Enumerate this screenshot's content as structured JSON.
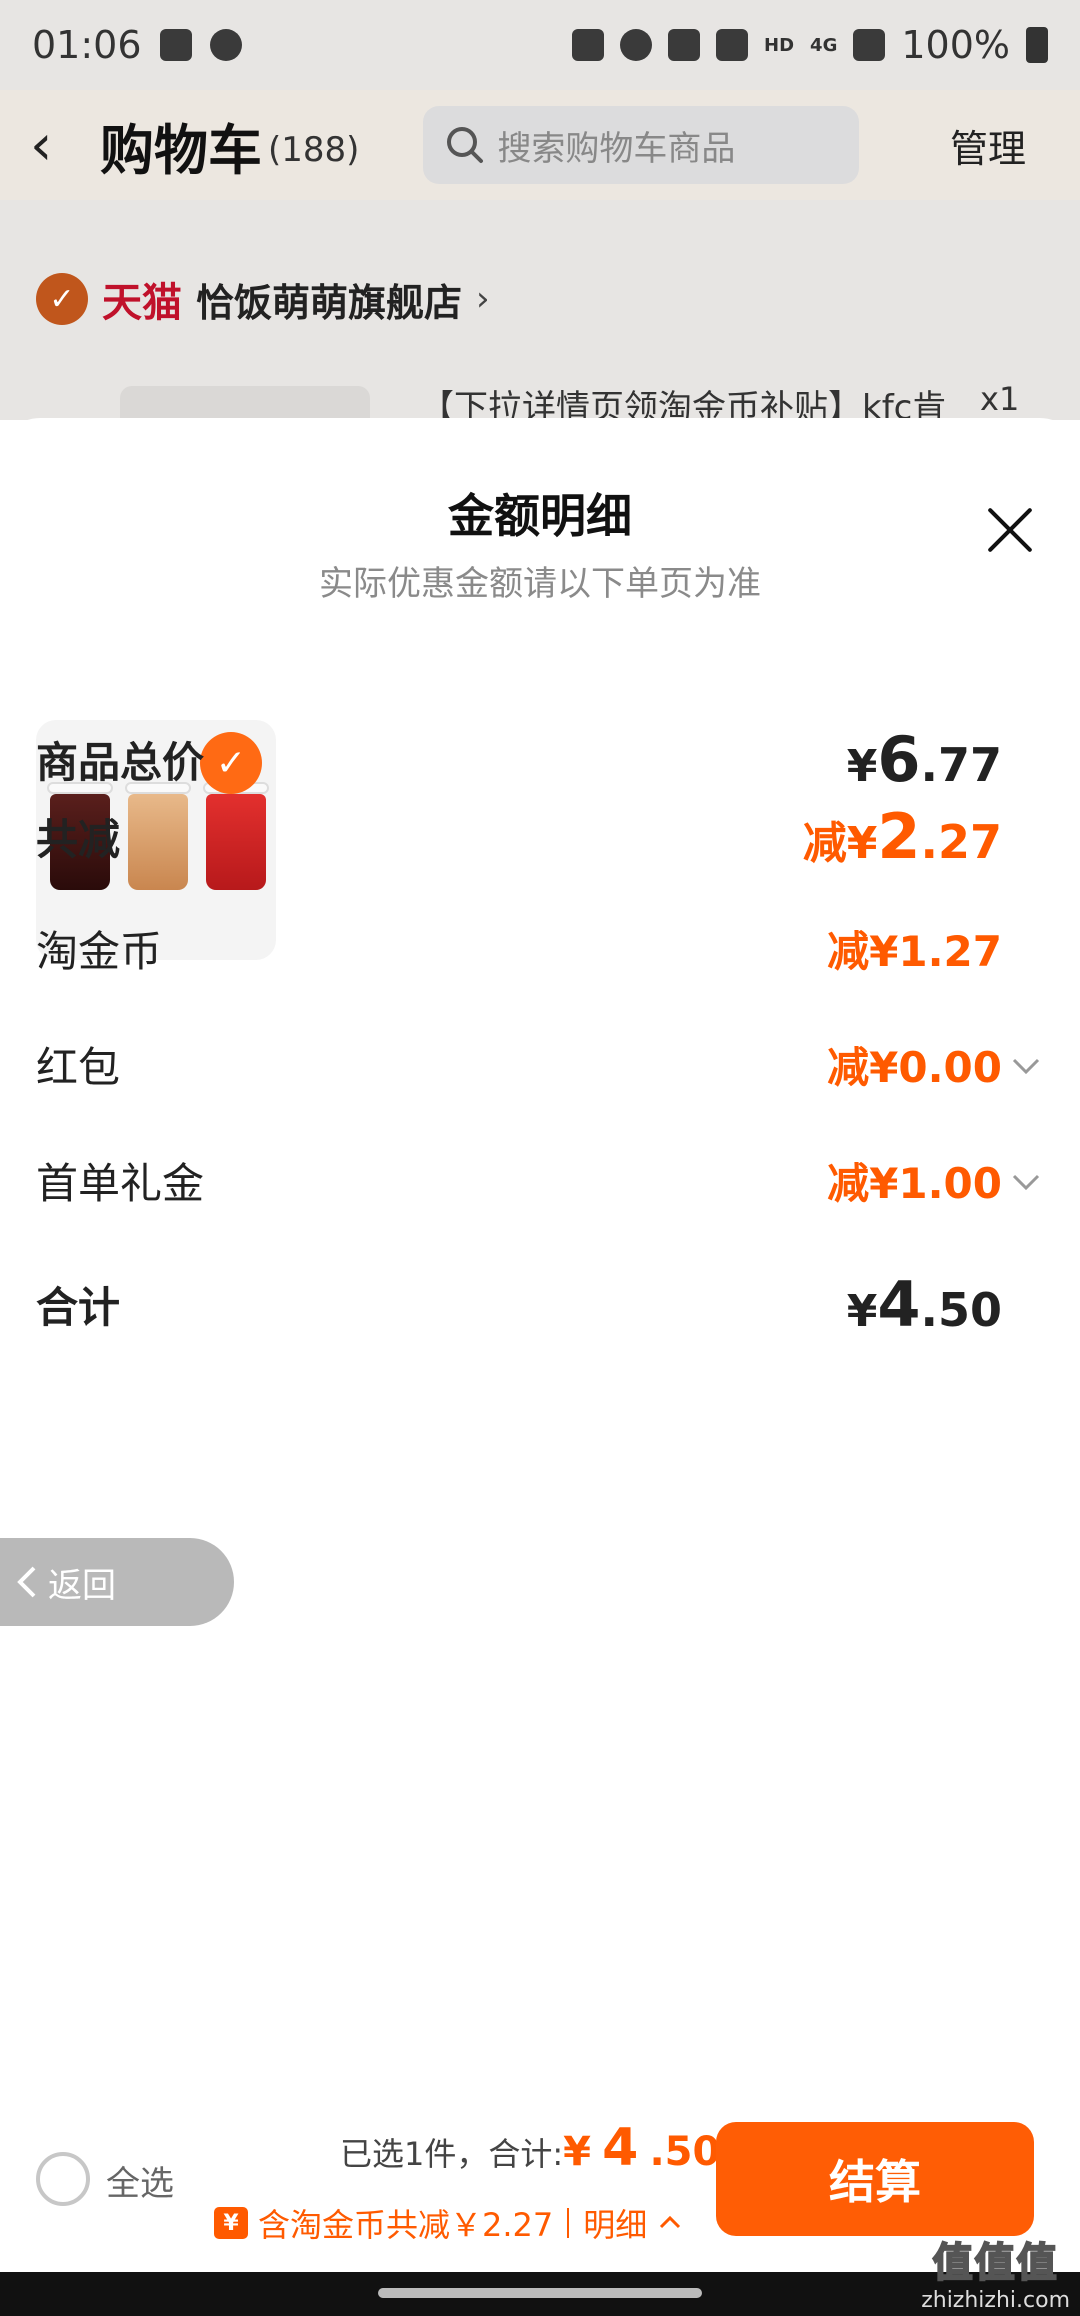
{
  "status_bar": {
    "time": "01:06",
    "network": "HD",
    "signal_label": "4G",
    "battery": "100%"
  },
  "header": {
    "title": "购物车",
    "count": "(188)",
    "search_placeholder": "搜索购物车商品",
    "manage_label": "管理"
  },
  "store": {
    "badge": "天猫",
    "name": "恰饭萌萌旗舰店",
    "product_peek": "【下拉详情页领淘金币补贴】kfc肯",
    "qty_peek": "x1"
  },
  "sheet": {
    "title": "金额明细",
    "subtitle": "实际优惠金额请以下单页为准",
    "rows": [
      {
        "label": "商品总价",
        "prefix": "¥",
        "int": "6",
        "dec": ".77"
      },
      {
        "label": "共减",
        "prefix": "减¥",
        "int": "2",
        "dec": ".27"
      },
      {
        "label": "淘金币",
        "value": "减¥1.27"
      },
      {
        "label": "红包",
        "value": "减¥0.00"
      },
      {
        "label": "首单礼金",
        "value": "减¥1.00"
      },
      {
        "label": "合计",
        "prefix": "¥",
        "int": "4",
        "dec": ".50"
      }
    ]
  },
  "back_pill": {
    "label": "返回"
  },
  "checkout": {
    "select_all": "全选",
    "selected_text": "已选1件，合计:",
    "total_prefix": "¥",
    "total_int": "4",
    "total_dec": ".50",
    "coin_badge": "¥",
    "coin_text": "含淘金币共减￥2.27",
    "detail_label": "明细",
    "button_label": "结算"
  },
  "watermark": {
    "logo": "值值值",
    "url": "zhizhizhi.com"
  },
  "colors": {
    "accent": "#ff5a00",
    "tmall": "#c0112b",
    "button": "#ff5d05"
  }
}
